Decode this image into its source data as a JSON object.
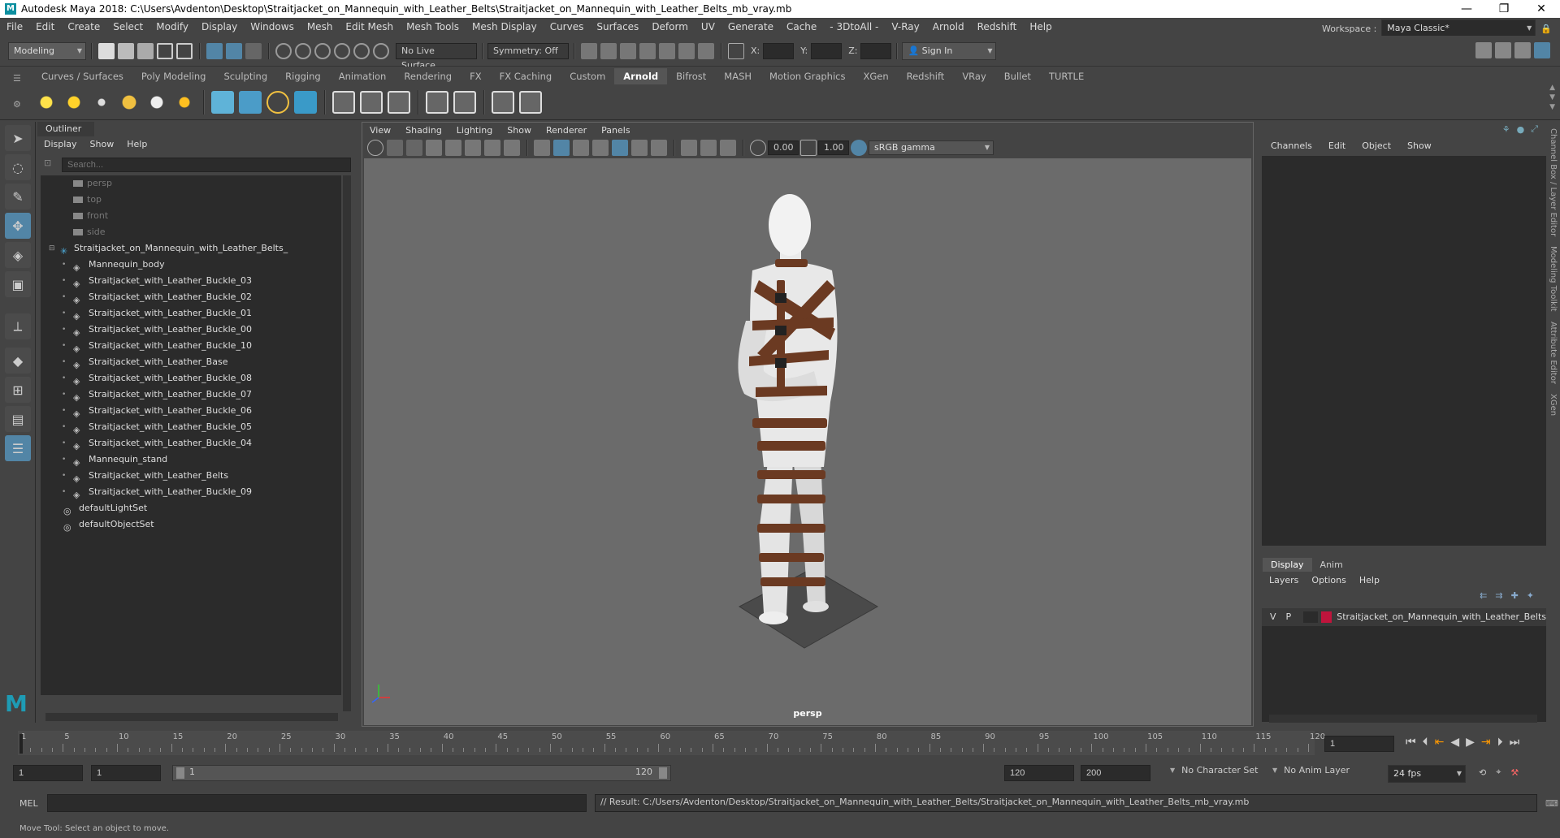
{
  "window": {
    "title": "Autodesk Maya 2018: C:\\Users\\Avdenton\\Desktop\\Straitjacket_on_Mannequin_with_Leather_Belts\\Straitjacket_on_Mannequin_with_Leather_Belts_mb_vray.mb"
  },
  "menubar": {
    "items": [
      "File",
      "Edit",
      "Create",
      "Select",
      "Modify",
      "Display",
      "Windows",
      "Mesh",
      "Edit Mesh",
      "Mesh Tools",
      "Mesh Display",
      "Curves",
      "Surfaces",
      "Deform",
      "UV",
      "Generate",
      "Cache",
      "- 3DtoAll -",
      "V-Ray",
      "Arnold",
      "Redshift",
      "Help"
    ],
    "workspace_label": "Workspace :",
    "workspace_value": "Maya Classic*"
  },
  "statusline": {
    "mode": "Modeling",
    "live_surface": "No Live Surface",
    "symmetry": "Symmetry: Off",
    "x_label": "X:",
    "y_label": "Y:",
    "z_label": "Z:",
    "sign_in": "Sign In"
  },
  "shelf": {
    "tabs": [
      "Curves / Surfaces",
      "Poly Modeling",
      "Sculpting",
      "Rigging",
      "Animation",
      "Rendering",
      "FX",
      "FX Caching",
      "Custom",
      "Arnold",
      "Bifrost",
      "MASH",
      "Motion Graphics",
      "XGen",
      "Redshift",
      "VRay",
      "Bullet",
      "TURTLE"
    ],
    "active_tab": "Arnold"
  },
  "outliner": {
    "title": "Outliner",
    "menu": [
      "Display",
      "Show",
      "Help"
    ],
    "search_placeholder": "Search...",
    "items": [
      {
        "label": "persp",
        "type": "camera",
        "indent": 1,
        "dim": true
      },
      {
        "label": "top",
        "type": "camera",
        "indent": 1,
        "dim": true
      },
      {
        "label": "front",
        "type": "camera",
        "indent": 1,
        "dim": true
      },
      {
        "label": "side",
        "type": "camera",
        "indent": 1,
        "dim": true
      },
      {
        "label": "Straitjacket_on_Mannequin_with_Leather_Belts_",
        "type": "group",
        "indent": 0,
        "expanded": true
      },
      {
        "label": "Mannequin_body",
        "type": "mesh",
        "indent": 2
      },
      {
        "label": "Straitjacket_with_Leather_Buckle_03",
        "type": "mesh",
        "indent": 2
      },
      {
        "label": "Straitjacket_with_Leather_Buckle_02",
        "type": "mesh",
        "indent": 2
      },
      {
        "label": "Straitjacket_with_Leather_Buckle_01",
        "type": "mesh",
        "indent": 2
      },
      {
        "label": "Straitjacket_with_Leather_Buckle_00",
        "type": "mesh",
        "indent": 2
      },
      {
        "label": "Straitjacket_with_Leather_Buckle_10",
        "type": "mesh",
        "indent": 2
      },
      {
        "label": "Straitjacket_with_Leather_Base",
        "type": "mesh",
        "indent": 2
      },
      {
        "label": "Straitjacket_with_Leather_Buckle_08",
        "type": "mesh",
        "indent": 2
      },
      {
        "label": "Straitjacket_with_Leather_Buckle_07",
        "type": "mesh",
        "indent": 2
      },
      {
        "label": "Straitjacket_with_Leather_Buckle_06",
        "type": "mesh",
        "indent": 2
      },
      {
        "label": "Straitjacket_with_Leather_Buckle_05",
        "type": "mesh",
        "indent": 2
      },
      {
        "label": "Straitjacket_with_Leather_Buckle_04",
        "type": "mesh",
        "indent": 2
      },
      {
        "label": "Mannequin_stand",
        "type": "mesh",
        "indent": 2
      },
      {
        "label": "Straitjacket_with_Leather_Belts",
        "type": "mesh",
        "indent": 2
      },
      {
        "label": "Straitjacket_with_Leather_Buckle_09",
        "type": "mesh",
        "indent": 2
      },
      {
        "label": "defaultLightSet",
        "type": "set",
        "indent": 1
      },
      {
        "label": "defaultObjectSet",
        "type": "set",
        "indent": 1
      }
    ]
  },
  "viewport": {
    "menu": [
      "View",
      "Shading",
      "Lighting",
      "Show",
      "Renderer",
      "Panels"
    ],
    "exposure": "0.00",
    "gamma": "1.00",
    "colorspace": "sRGB gamma",
    "camera": "persp"
  },
  "channelbox": {
    "menu": [
      "Channels",
      "Edit",
      "Object",
      "Show"
    ]
  },
  "layereditor": {
    "tabs": [
      "Display",
      "Anim"
    ],
    "active_tab": "Display",
    "menu": [
      "Layers",
      "Options",
      "Help"
    ],
    "layer": {
      "v": "V",
      "p": "P",
      "name": "Straitjacket_on_Mannequin_with_Leather_Belts",
      "color": "#c0143c"
    }
  },
  "sidetabs": [
    "Channel Box / Layer Editor",
    "Modeling Toolkit",
    "Attribute Editor",
    "XGen"
  ],
  "timeline": {
    "ticks": [
      1,
      5,
      10,
      15,
      20,
      25,
      30,
      35,
      40,
      45,
      50,
      55,
      60,
      65,
      70,
      75,
      80,
      85,
      90,
      95,
      100,
      105,
      110,
      115,
      120
    ],
    "current_frame": "1",
    "range_start": "1",
    "playback_start": "1",
    "range_slider_start": "1",
    "range_slider_end": "120",
    "playback_end": "120",
    "anim_end": "200",
    "character_set": "No Character Set",
    "anim_layer": "No Anim Layer",
    "fps": "24 fps"
  },
  "commandline": {
    "lang": "MEL",
    "result": "// Result: C:/Users/Avdenton/Desktop/Straitjacket_on_Mannequin_with_Leather_Belts/Straitjacket_on_Mannequin_with_Leather_Belts_mb_vray.mb"
  },
  "helpline": "Move Tool: Select an object to move.",
  "colors": {
    "accent": "#5285a6",
    "leather": "#6b3a22",
    "fabric": "#e6e6e6",
    "viewport_bg": "#6b6b6b"
  }
}
